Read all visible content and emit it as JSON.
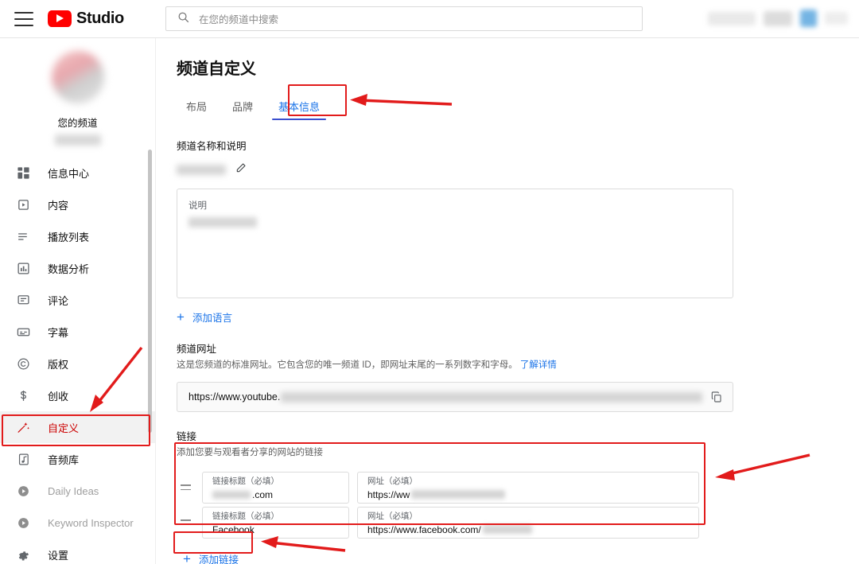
{
  "header": {
    "menu_icon": "hamburger-menu-icon",
    "logo_icon": "youtube-logo-icon",
    "brand": "Studio",
    "search_icon": "search-icon",
    "search_placeholder": "在您的频道中搜索",
    "search_value": ""
  },
  "sidebar": {
    "your_channel_label": "您的频道",
    "avatar_icon": "channel-avatar",
    "items": [
      {
        "label": "信息中心",
        "icon": "dashboard-icon",
        "state": "normal"
      },
      {
        "label": "内容",
        "icon": "video-content-icon",
        "state": "normal"
      },
      {
        "label": "播放列表",
        "icon": "playlist-icon",
        "state": "normal"
      },
      {
        "label": "数据分析",
        "icon": "analytics-icon",
        "state": "normal"
      },
      {
        "label": "评论",
        "icon": "comments-icon",
        "state": "normal"
      },
      {
        "label": "字幕",
        "icon": "subtitles-icon",
        "state": "normal"
      },
      {
        "label": "版权",
        "icon": "copyright-icon",
        "state": "normal"
      },
      {
        "label": "创收",
        "icon": "monetization-icon",
        "state": "normal"
      },
      {
        "label": "自定义",
        "icon": "customization-wand-icon",
        "state": "active"
      },
      {
        "label": "音频库",
        "icon": "audio-library-icon",
        "state": "normal"
      },
      {
        "label": "Daily Ideas",
        "icon": "extension-icon",
        "state": "dim"
      },
      {
        "label": "Keyword Inspector",
        "icon": "extension-icon",
        "state": "dim"
      },
      {
        "label": "设置",
        "icon": "gear-icon",
        "state": "normal"
      }
    ]
  },
  "main": {
    "page_title": "频道自定义",
    "tabs": [
      {
        "label": "布局",
        "active": false
      },
      {
        "label": "品牌",
        "active": false
      },
      {
        "label": "基本信息",
        "active": true
      }
    ],
    "name_section": {
      "label": "频道名称和说明",
      "edit_icon": "pencil-edit-icon",
      "description_label": "说明"
    },
    "add_language": "添加语言",
    "url_section": {
      "label": "频道网址",
      "description": "这是您频道的标准网址。它包含您的唯一频道 ID，即网址末尾的一系列数字和字母。",
      "learn_more": "了解详情",
      "url_prefix": "https://www.youtube.",
      "copy_icon": "copy-icon"
    },
    "links_section": {
      "label": "链接",
      "description": "添加您要与观看者分享的网站的链接",
      "title_label": "链接标题（必填）",
      "url_label": "网址（必填）",
      "rows": [
        {
          "drag_icon": "drag-handle-icon",
          "title_value": ".com",
          "url_value": "https://ww"
        },
        {
          "drag_icon": "drag-handle-icon",
          "title_value": "Facebook",
          "url_value": "https://www.facebook.com/"
        }
      ],
      "add_link": "添加链接"
    }
  },
  "annotations": {
    "color": "#e21b1b",
    "boxes": [
      "tab-基本信息",
      "sidebar-自定义",
      "links-rows",
      "add-link-button"
    ],
    "arrows": [
      "arrow-to-tab",
      "arrow-to-sidebar-item",
      "arrow-to-links",
      "arrow-to-add-link"
    ]
  }
}
